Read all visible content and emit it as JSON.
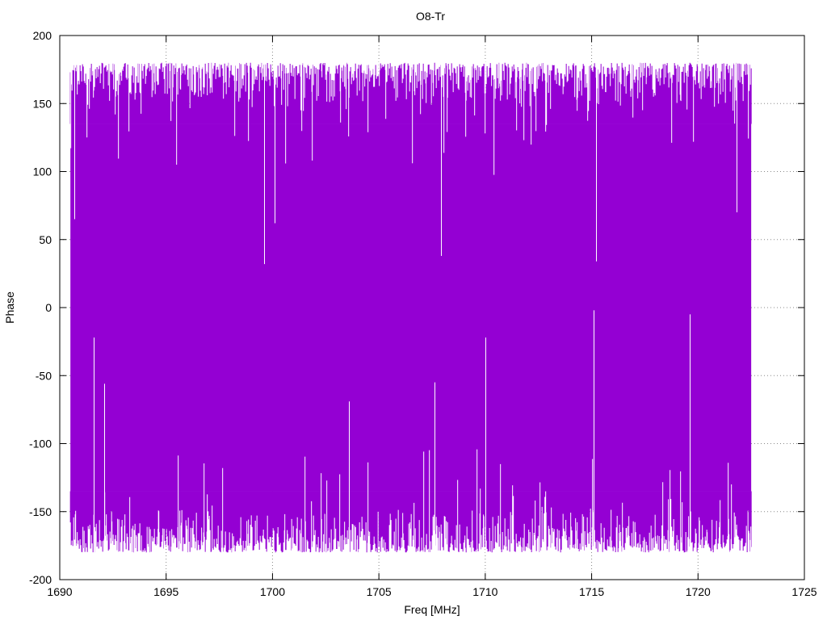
{
  "chart_data": {
    "type": "line",
    "title": "O8-Tr",
    "xlabel": "Freq [MHz]",
    "ylabel": "Phase",
    "xlim": [
      1690,
      1725
    ],
    "ylim": [
      -200,
      200
    ],
    "xticks": [
      1690,
      1695,
      1700,
      1705,
      1710,
      1715,
      1720,
      1725
    ],
    "yticks": [
      -200,
      -150,
      -100,
      -50,
      0,
      50,
      100,
      150,
      200
    ],
    "grid": true,
    "grid_style": "dotted",
    "series": [
      {
        "color": "#9400d3",
        "x_range": [
          1690.5,
          1722.5
        ],
        "phase_wrap": [
          -180,
          180
        ],
        "envelope_high": 175,
        "envelope_low": -175,
        "description_of_spikes": [
          {
            "x": 1699.6,
            "y": 32
          },
          {
            "x": 1700.1,
            "y": 62
          },
          {
            "x": 1707.9,
            "y": 38
          },
          {
            "x": 1715.1,
            "y": -2
          },
          {
            "x": 1715.2,
            "y": 34
          },
          {
            "x": 1721.8,
            "y": 70
          },
          {
            "x": 1691.6,
            "y": -22
          },
          {
            "x": 1692.1,
            "y": -56
          },
          {
            "x": 1703.6,
            "y": -69
          },
          {
            "x": 1707.6,
            "y": -55
          },
          {
            "x": 1710.0,
            "y": -22
          },
          {
            "x": 1719.6,
            "y": -5
          },
          {
            "x": 1690.7,
            "y": 65
          }
        ]
      }
    ]
  }
}
